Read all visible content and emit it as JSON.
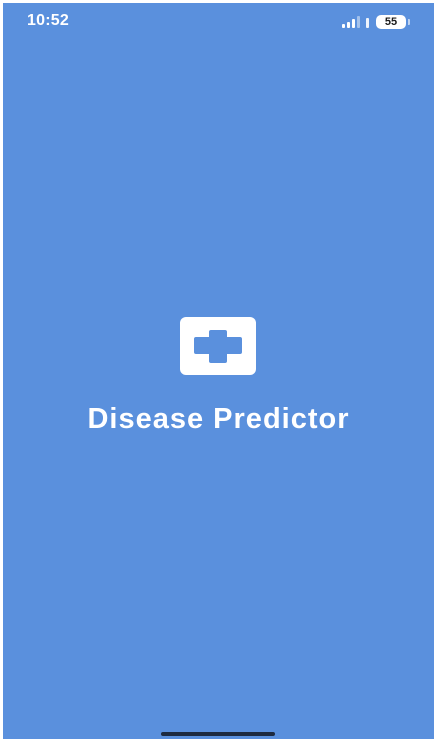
{
  "status_bar": {
    "time": "10:52",
    "battery_level": "55"
  },
  "splash": {
    "title": "Disease Predictor",
    "logo_icon": "medical-cross-icon"
  },
  "colors": {
    "background": "#5a90dd",
    "foreground": "#ffffff"
  }
}
